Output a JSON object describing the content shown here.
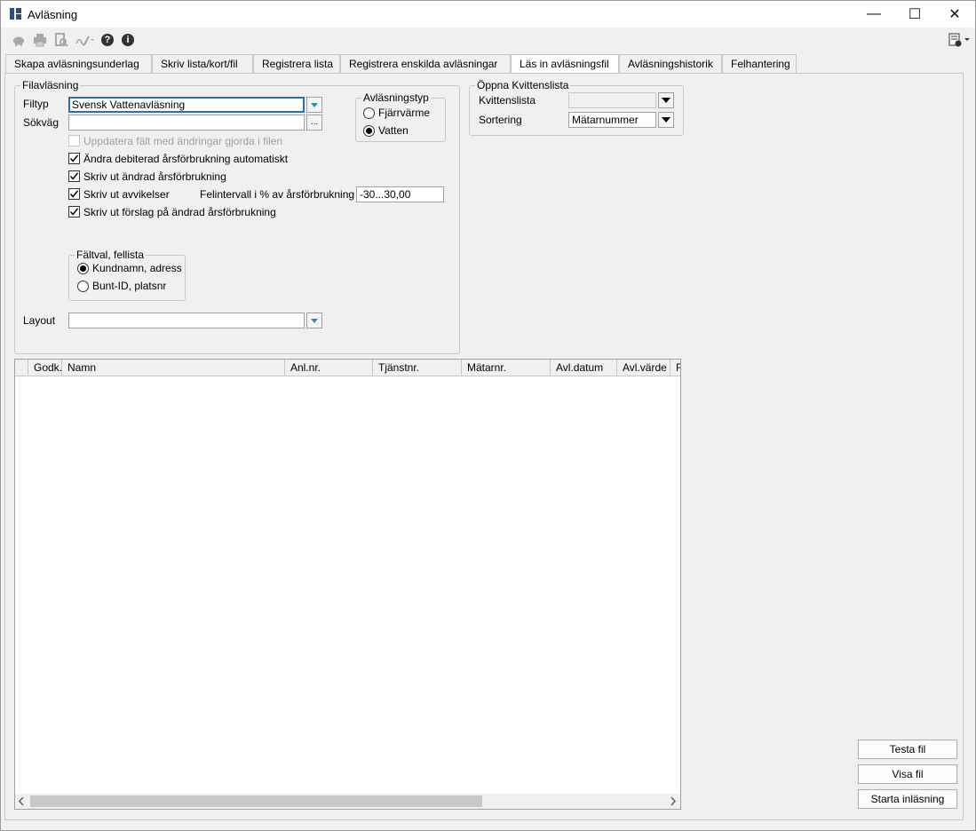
{
  "window": {
    "title": "Avläsning",
    "minimize": "—",
    "maximize": "☐",
    "close": "✕"
  },
  "tabs": [
    {
      "label": "Skapa avläsningsunderlag"
    },
    {
      "label": "Skriv lista/kort/fil"
    },
    {
      "label": "Registrera lista"
    },
    {
      "label": "Registrera enskilda avläsningar"
    },
    {
      "label": "Läs in avläsningsfil"
    },
    {
      "label": "Avläsningshistorik"
    },
    {
      "label": "Felhantering"
    }
  ],
  "filavlasning": {
    "legend": "Filavläsning",
    "filtyp_label": "Filtyp",
    "filtyp_value": "Svensk Vattenavläsning",
    "sokvag_label": "Sökväg",
    "sokvag_value": "",
    "browse_label": "...",
    "checks": [
      {
        "label": "Uppdatera fält med ändringar gjorda i filen",
        "checked": false,
        "disabled": true
      },
      {
        "label": "Ändra debiterad årsförbrukning automatiskt",
        "checked": true
      },
      {
        "label": "Skriv ut ändrad årsförbrukning",
        "checked": true
      },
      {
        "label": "Skriv ut avvikelser",
        "checked": true
      },
      {
        "label": "Skriv ut förslag på ändrad årsförbrukning",
        "checked": true
      }
    ],
    "felintervall_label": "Felintervall i % av årsförbrukning",
    "felintervall_value": "-30...30,00",
    "avlasningstyp": {
      "legend": "Avläsningstyp",
      "options": [
        "Fjärrvärme",
        "Vatten"
      ],
      "selected": "Vatten"
    },
    "faltval": {
      "legend": "Fältval, fellista",
      "options": [
        "Kundnamn, adress",
        "Bunt-ID, platsnr"
      ],
      "selected": "Kundnamn, adress"
    },
    "layout_label": "Layout",
    "layout_value": ""
  },
  "kvittens": {
    "legend": "Öppna Kvittenslista",
    "kvittenslista_label": "Kvittenslista",
    "kvittenslista_value": "",
    "sortering_label": "Sortering",
    "sortering_value": "Mätarnummer"
  },
  "grid": {
    "columns": [
      "Godk.",
      "Namn",
      "Anl.nr.",
      "Tjänstnr.",
      "Mätarnr.",
      "Avl.datum",
      "Avl.värde",
      "F"
    ]
  },
  "buttons": {
    "testa": "Testa fil",
    "visa": "Visa fil",
    "starta": "Starta inläsning"
  }
}
